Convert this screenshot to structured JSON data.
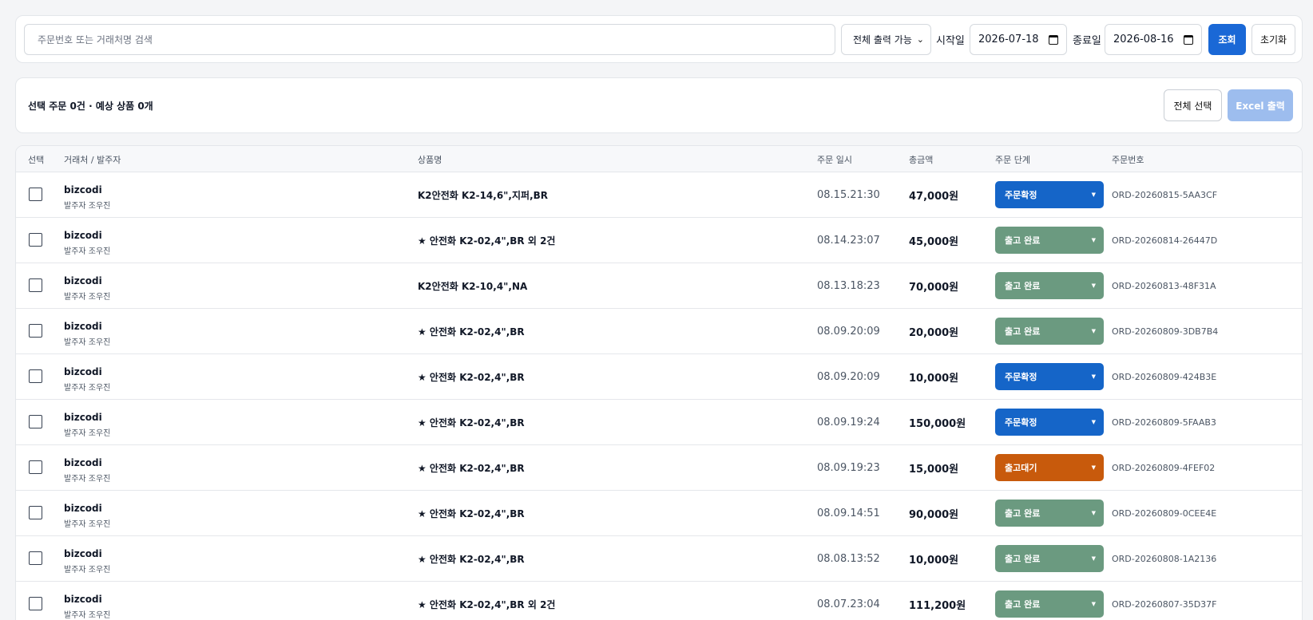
{
  "search": {
    "placeholder": "주문번호 또는 거래처명 검색",
    "filter_selected": "전체 출력 가능",
    "start_label": "시작일",
    "start_value": "2026-07-18",
    "end_label": "종료일",
    "end_value": "2026-08-16",
    "query_label": "조회",
    "reset_label": "초기화"
  },
  "summary": {
    "text": "선택 주문 0건 · 예상 상품 0개",
    "select_all_label": "전체 선택",
    "excel_label": "Excel 출력"
  },
  "table": {
    "headers": [
      "선택",
      "거래처 / 발주자",
      "상품명",
      "주문 일시",
      "총금액",
      "주문 단계",
      "주문번호"
    ],
    "rows": [
      {
        "client": "bizcodi",
        "orderer": "발주자 조우진",
        "product": "K2안전화 K2-14,6\",지퍼,BR",
        "date": "08.15.21:30",
        "amount": "47,000원",
        "stage": "주문확정",
        "order_no": "ORD-20260815-5AA3CF"
      },
      {
        "client": "bizcodi",
        "orderer": "발주자 조우진",
        "product": "★ 안전화 K2-02,4\",BR 외 2건",
        "date": "08.14.23:07",
        "amount": "45,000원",
        "stage": "출고 완료",
        "order_no": "ORD-20260814-26447D"
      },
      {
        "client": "bizcodi",
        "orderer": "발주자 조우진",
        "product": "K2안전화 K2-10,4\",NA",
        "date": "08.13.18:23",
        "amount": "70,000원",
        "stage": "출고 완료",
        "order_no": "ORD-20260813-48F31A"
      },
      {
        "client": "bizcodi",
        "orderer": "발주자 조우진",
        "product": "★ 안전화 K2-02,4\",BR",
        "date": "08.09.20:09",
        "amount": "20,000원",
        "stage": "출고 완료",
        "order_no": "ORD-20260809-3DB7B4"
      },
      {
        "client": "bizcodi",
        "orderer": "발주자 조우진",
        "product": "★ 안전화 K2-02,4\",BR",
        "date": "08.09.20:09",
        "amount": "10,000원",
        "stage": "주문확정",
        "order_no": "ORD-20260809-424B3E"
      },
      {
        "client": "bizcodi",
        "orderer": "발주자 조우진",
        "product": "★ 안전화 K2-02,4\",BR",
        "date": "08.09.19:24",
        "amount": "150,000원",
        "stage": "주문확정",
        "order_no": "ORD-20260809-5FAAB3"
      },
      {
        "client": "bizcodi",
        "orderer": "발주자 조우진",
        "product": "★ 안전화 K2-02,4\",BR",
        "date": "08.09.19:23",
        "amount": "15,000원",
        "stage": "출고대기",
        "order_no": "ORD-20260809-4FEF02"
      },
      {
        "client": "bizcodi",
        "orderer": "발주자 조우진",
        "product": "★ 안전화 K2-02,4\",BR",
        "date": "08.09.14:51",
        "amount": "90,000원",
        "stage": "출고 완료",
        "order_no": "ORD-20260809-0CEE4E"
      },
      {
        "client": "bizcodi",
        "orderer": "발주자 조우진",
        "product": "★ 안전화 K2-02,4\",BR",
        "date": "08.08.13:52",
        "amount": "10,000원",
        "stage": "출고 완료",
        "order_no": "ORD-20260808-1A2136"
      },
      {
        "client": "bizcodi",
        "orderer": "발주자 조우진",
        "product": "★ 안전화 K2-02,4\",BR 외 2건",
        "date": "08.07.23:04",
        "amount": "111,200원",
        "stage": "출고 완료",
        "order_no": "ORD-20260807-35D37F"
      }
    ]
  },
  "stage_colors": {
    "주문확정": "#1565c8",
    "출고 완료": "#6b9a80",
    "출고대기": "#c85a0c"
  },
  "icons": {
    "select_chevron": "chevron-down-icon",
    "date_picker": "calendar-icon",
    "stage_caret": "caret-down-icon"
  }
}
